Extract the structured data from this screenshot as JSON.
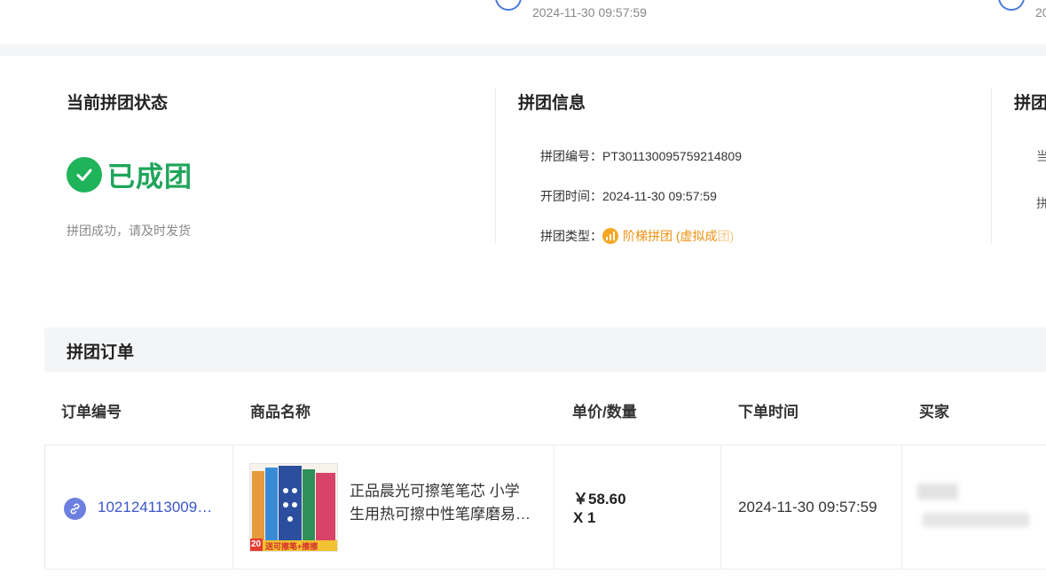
{
  "top": {
    "time1": "2024-11-30 09:57:59",
    "time2_clipped": "20"
  },
  "status_section": {
    "title": "当前拼团状态",
    "status": "已成团",
    "note": "拼团成功，请及时发货",
    "status_color": "#1fb35a"
  },
  "info_section": {
    "title": "拼团信息",
    "rows": [
      {
        "label": "拼团编号：",
        "value": "PT301130095759214809"
      },
      {
        "label": "开团时间：",
        "value": "2024-11-30 09:57:59"
      },
      {
        "label": "拼团类型：",
        "value_main": "阶梯拼团 (虚拟成",
        "value_faded": "团)"
      }
    ],
    "type_color": "#f0900f",
    "type_icon": "bar-chart-icon"
  },
  "third_section": {
    "title_clipped": "拼团",
    "row1_clipped": "当",
    "row2_clipped": "拼"
  },
  "orders": {
    "title": "拼团订单",
    "columns": [
      "订单编号",
      "商品名称",
      "单价/数量",
      "下单时间",
      "买家"
    ],
    "rows": [
      {
        "order_no": "102124113009…",
        "product_name_line1": "正品晨光可擦笔笔芯 小学",
        "product_name_line2": "生用热可擦中性笔摩磨易…",
        "price": "￥58.60",
        "qty": "X 1",
        "time": "2024-11-30 09:57:59",
        "thumb_text": "送可擦笔+擦擦",
        "thumb_badge": "20"
      }
    ],
    "link_color": "#3b55c9"
  }
}
